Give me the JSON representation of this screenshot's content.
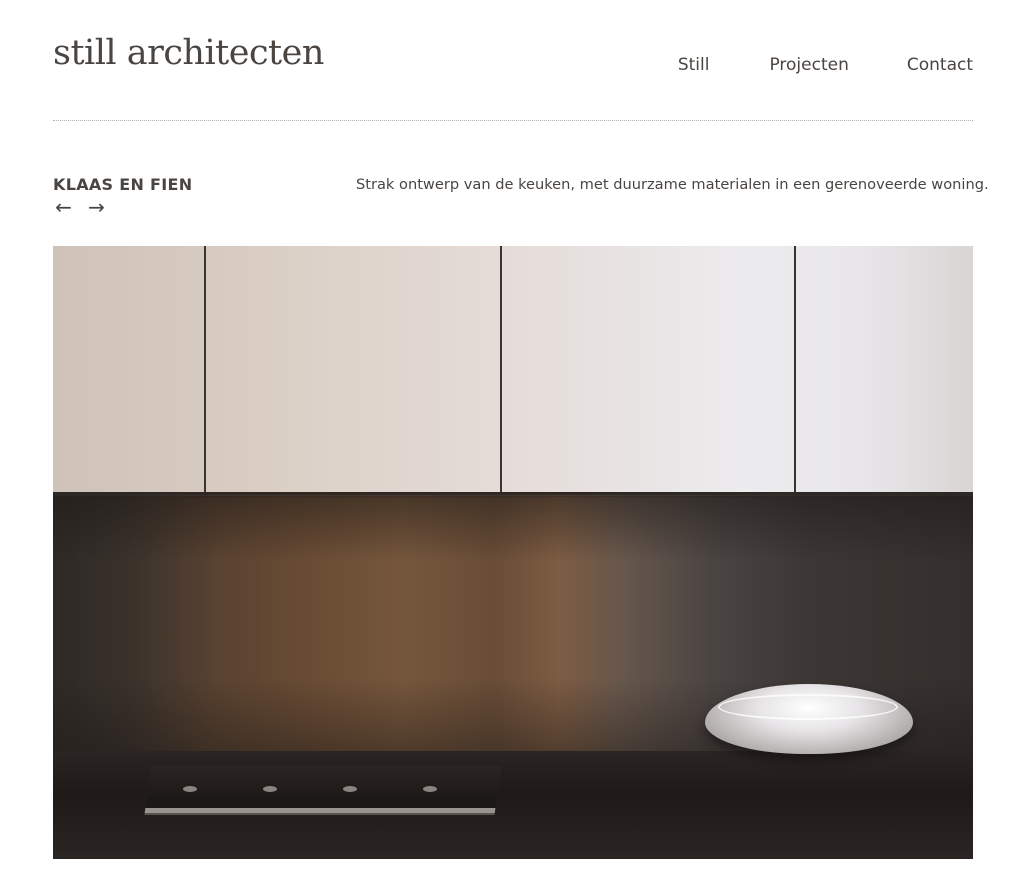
{
  "header": {
    "logo": "still architecten",
    "nav": [
      {
        "label": "Still"
      },
      {
        "label": "Projecten"
      },
      {
        "label": "Contact"
      }
    ]
  },
  "project": {
    "title": "KLAAS EN FIEN",
    "prev_arrow": "←",
    "next_arrow": "→",
    "description": "Strak ontwerp van de keuken, met duurzame materialen in een gerenoveerde woning."
  },
  "colors": {
    "text": "#4a4541",
    "divider": "#b5b0ab",
    "background": "#ffffff"
  },
  "icons": {
    "prev": "arrow-left-icon",
    "next": "arrow-right-icon"
  }
}
